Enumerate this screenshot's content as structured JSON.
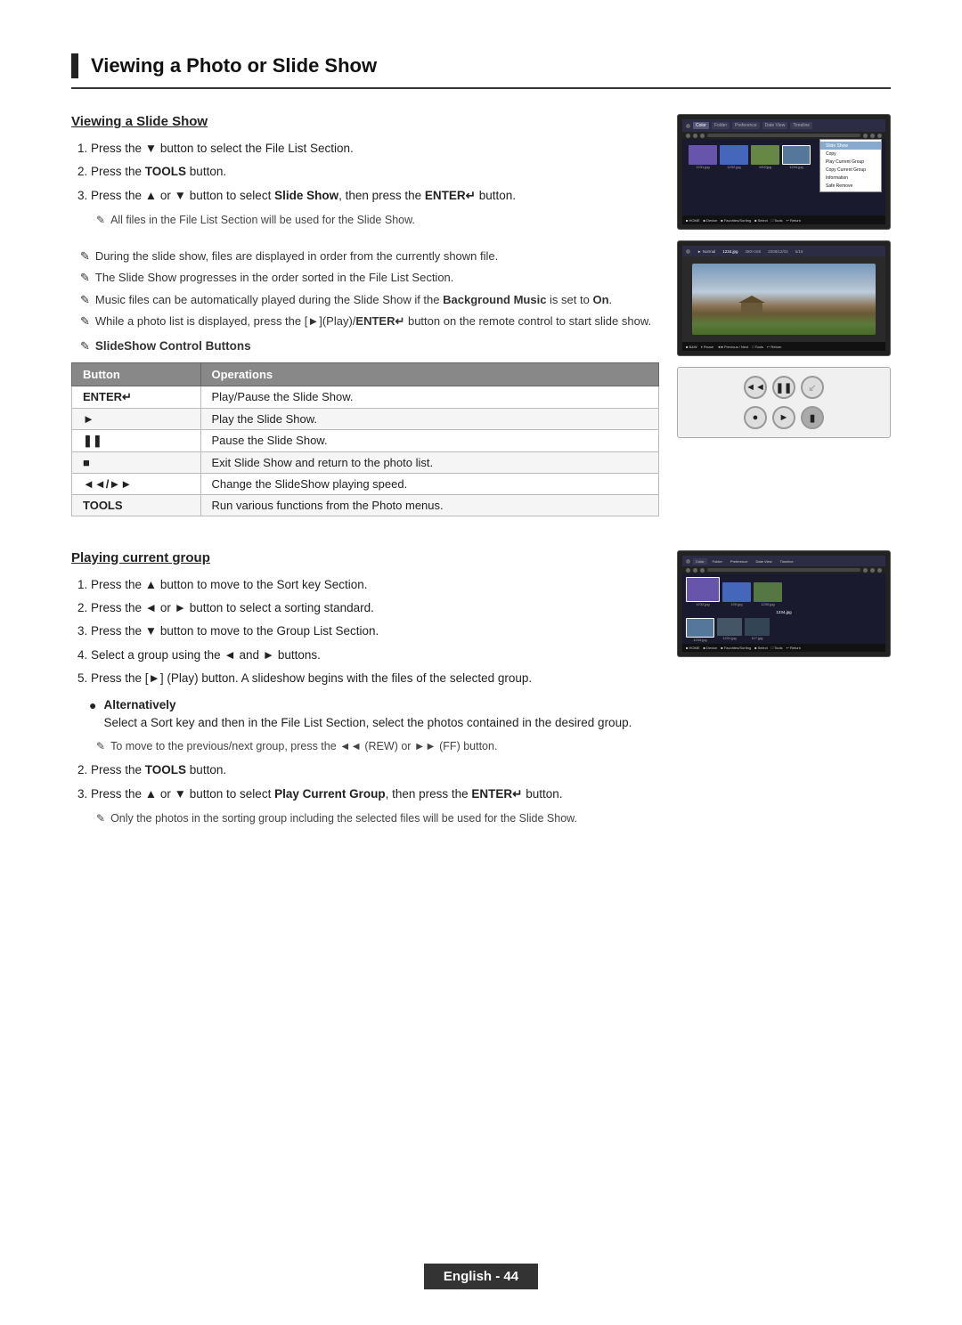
{
  "page": {
    "title": "Viewing a Photo or Slide Show",
    "footer": "English - 44"
  },
  "section1": {
    "title": "Viewing a Slide Show",
    "steps": [
      {
        "num": 1,
        "text": "Press the ▼ button to select the File List Section."
      },
      {
        "num": 2,
        "text": "Press the TOOLS button.",
        "bold_parts": [
          "TOOLS"
        ]
      },
      {
        "num": 3,
        "text": "Press the ▲ or ▼ button to select Slide Show, then press the ENTER↵ button.",
        "bold_parts": [
          "Slide Show",
          "ENTER↵"
        ]
      }
    ],
    "note1": "All files in the File List Section will be used for the Slide Show.",
    "notes": [
      "During the slide show, files are displayed in order from the currently shown file.",
      "The Slide Show progresses in the order sorted in the File List Section.",
      "Music files can be automatically played during the Slide Show if the Background Music is set to On.",
      "While a photo list is displayed, press the ►(Play)/ENTER↵ button on the remote control to start slide show."
    ],
    "note4_bold": [
      "Background",
      "Music"
    ],
    "note5_label": "SlideShow Control Buttons",
    "table": {
      "headers": [
        "Button",
        "Operations"
      ],
      "rows": [
        {
          "button": "ENTER↵",
          "operation": "Play/Pause the Slide Show."
        },
        {
          "button": "►",
          "operation": "Play the Slide Show."
        },
        {
          "button": "II",
          "operation": "Pause the Slide Show."
        },
        {
          "button": "■",
          "operation": "Exit Slide Show and return to the photo list."
        },
        {
          "button": "◄◄/►►",
          "operation": "Change the SlideShow playing speed."
        },
        {
          "button": "TOOLS",
          "operation": "Run various functions from the Photo menus."
        }
      ]
    }
  },
  "section2": {
    "title": "Playing current group",
    "steps": [
      {
        "num": 1,
        "text": "Press the ▲ button to move to the Sort key Section."
      },
      {
        "num": 2,
        "text": "Press the ◄ or ► button to select a sorting standard."
      },
      {
        "num": 3,
        "text": "Press the ▼ button to move to the Group List Section."
      },
      {
        "num": 4,
        "text": "Select a group using the ◄ and ► buttons."
      },
      {
        "num": 5,
        "text": "Press the ►(Play) button. A slideshow begins with the files of the selected group."
      }
    ],
    "alternatively_label": "Alternatively",
    "alt_text": "Select a Sort key and then in the File List Section, select the photos contained in the desired group.",
    "alt_note": "To move to the previous/next group, press the ◄◄ (REW) or ►► (FF) button.",
    "step2b": "Press the TOOLS button.",
    "step3b_text": "Press the ▲ or ▼ button to select Play Current Group, then press the ENTER↵ button.",
    "step3b_bold": [
      "Play Current Group",
      "ENTER↵"
    ],
    "step3b_note": "Only the photos in the sorting group including the selected files will be used for the Slide Show."
  },
  "icons": {
    "note_icon": "✎",
    "bullet": "•",
    "rewind_btn": "◄◄",
    "pause_btn": "❚❚",
    "stop_btn": "■",
    "play_btn": "►",
    "forward_btn": "►►"
  },
  "context_menu": {
    "items": [
      "Slide Show",
      "Copy",
      "Play Current Group",
      "Copy Current Group",
      "Information",
      "Safe Remove"
    ]
  },
  "footer_text": "English - 44"
}
